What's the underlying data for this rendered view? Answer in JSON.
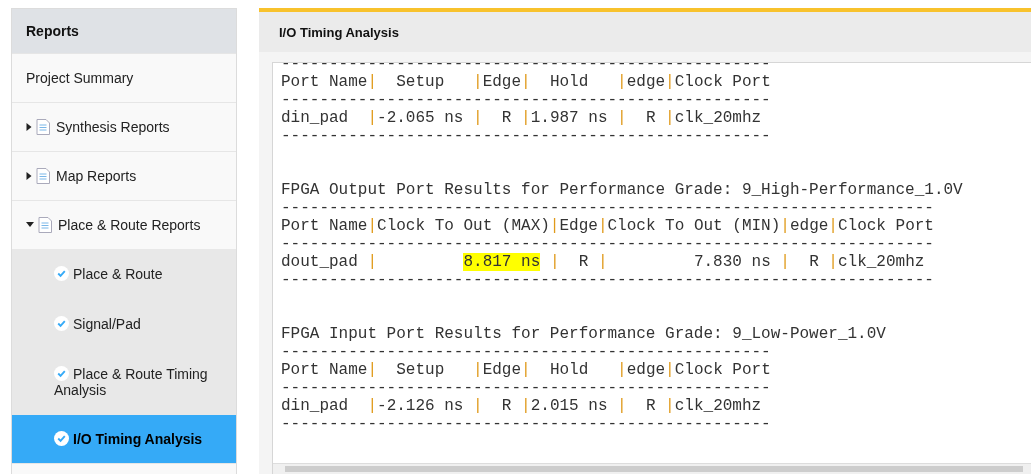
{
  "sidebar": {
    "title": "Reports",
    "items": [
      {
        "label": "Project Summary",
        "selected": false
      },
      {
        "label": "Synthesis Reports",
        "expanded": false,
        "selected": false
      },
      {
        "label": "Map Reports",
        "expanded": false,
        "selected": false
      },
      {
        "label": "Place & Route Reports",
        "expanded": true,
        "selected": false,
        "children": [
          {
            "label": "Place & Route",
            "selected": false
          },
          {
            "label": "Signal/Pad",
            "selected": false
          },
          {
            "label": "Place & Route Timing Analysis",
            "selected": false
          },
          {
            "label": "I/O Timing Analysis",
            "selected": true
          }
        ]
      }
    ]
  },
  "panel": {
    "title": "I/O Timing Analysis",
    "report_blocks": [
      [
        [
          {
            "text": "---------------------------------------------------"
          }
        ],
        [
          {
            "text": "Port Name|  Setup   |Edge|  Hold   |edge|Clock Port"
          }
        ],
        [
          {
            "text": "---------------------------------------------------"
          }
        ],
        [
          {
            "text": "din_pad  |-2.065 ns |  R |1.987 ns |  R |clk_20mhz"
          }
        ],
        [
          {
            "text": "---------------------------------------------------"
          }
        ]
      ],
      [
        [
          {
            "text": "FPGA Output Port Results for Performance Grade: 9_High-Performance_1.0V"
          }
        ],
        [
          {
            "text": "--------------------------------------------------------------------"
          }
        ],
        [
          {
            "text": "Port Name|Clock To Out (MAX)|Edge|Clock To Out (MIN)|edge|Clock Port"
          }
        ],
        [
          {
            "text": "--------------------------------------------------------------------"
          }
        ],
        [
          {
            "text": "dout_pad |         "
          },
          {
            "text": "8.817 ns",
            "highlight": true
          },
          {
            "text": " |  R |         7.830 ns |  R |clk_20mhz"
          }
        ],
        [
          {
            "text": "--------------------------------------------------------------------"
          }
        ]
      ],
      [
        [
          {
            "text": "FPGA Input Port Results for Performance Grade: 9_Low-Power_1.0V"
          }
        ],
        [
          {
            "text": "---------------------------------------------------"
          }
        ],
        [
          {
            "text": "Port Name|  Setup   |Edge|  Hold   |edge|Clock Port"
          }
        ],
        [
          {
            "text": "---------------------------------------------------"
          }
        ],
        [
          {
            "text": "din_pad  |-2.126 ns |  R |2.015 ns |  R |clk_20mhz"
          }
        ],
        [
          {
            "text": "---------------------------------------------------"
          }
        ]
      ]
    ]
  }
}
